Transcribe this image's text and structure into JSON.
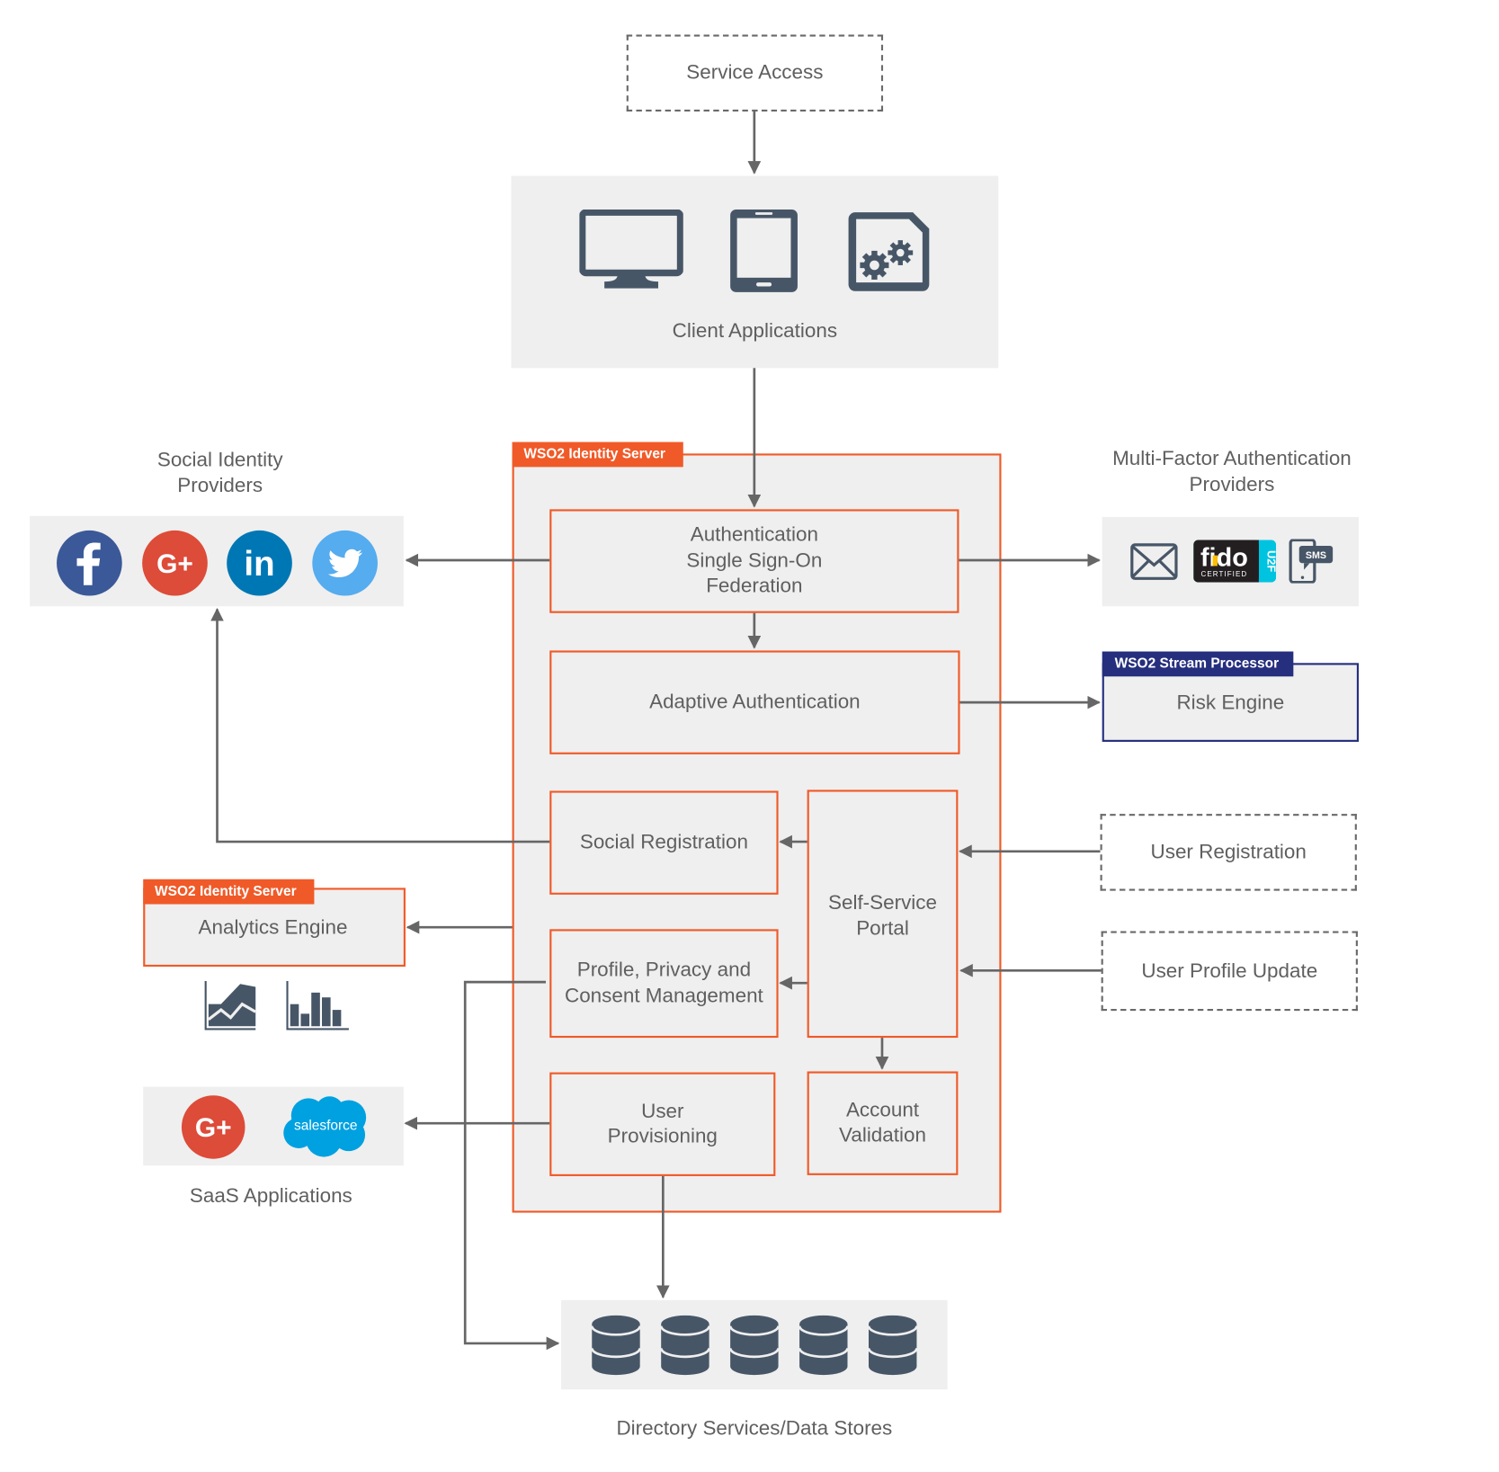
{
  "colors": {
    "accent_orange": "#f05a28",
    "stream_navy": "#252f7d",
    "icon_slate": "#475667",
    "panel_gray": "#efefef",
    "line_gray": "#666666",
    "facebook": "#3b5998",
    "google_plus": "#dd4b39",
    "linkedin": "#0077b5",
    "twitter": "#55acee",
    "salesforce": "#00a1e0",
    "fido_yellow": "#ffbf00",
    "u2f_cyan": "#00c3e0"
  },
  "service_access": {
    "label": "Service Access"
  },
  "client_applications": {
    "label": "Client Applications",
    "icons": [
      "desktop-icon",
      "tablet-icon",
      "app-gears-icon"
    ]
  },
  "identity_server": {
    "tag": "WSO2 Identity Server",
    "auth_box": "Authentication\nSingle Sign-On\nFederation",
    "adaptive_auth": "Adaptive Authentication",
    "social_registration": "Social Registration",
    "self_service_portal": "Self-Service\nPortal",
    "profile_privacy": "Profile, Privacy and\nConsent Management",
    "user_provisioning": "User\nProvisioning",
    "account_validation": "Account\nValidation"
  },
  "social_idp": {
    "title": "Social Identity\nProviders",
    "icons": [
      "facebook-icon",
      "google-plus-icon",
      "linkedin-icon",
      "twitter-icon"
    ],
    "glyphs": {
      "facebook": "f",
      "google_plus": "G+",
      "linkedin": "in"
    }
  },
  "mfa": {
    "title": "Multi-Factor Authentication\nProviders",
    "icons": [
      "email-icon",
      "fido-u2f-icon",
      "sms-icon"
    ],
    "fido_text": "fido",
    "fido_certified": "CERTIFIED",
    "u2f": "U2F",
    "sms": "SMS"
  },
  "risk_engine": {
    "tag": "WSO2 Stream Processor",
    "label": "Risk Engine"
  },
  "analytics": {
    "tag": "WSO2 Identity Server",
    "label": "Analytics Engine",
    "icons": [
      "area-chart-icon",
      "bar-chart-icon"
    ]
  },
  "saas": {
    "label": "SaaS Applications",
    "icons": [
      "google-plus-icon",
      "salesforce-icon"
    ],
    "salesforce_text": "salesforce",
    "gplus_text": "G+"
  },
  "user_registration": {
    "label": "User Registration"
  },
  "user_profile_update": {
    "label": "User Profile Update"
  },
  "data_stores": {
    "label": "Directory Services/Data Stores",
    "count": 5
  }
}
